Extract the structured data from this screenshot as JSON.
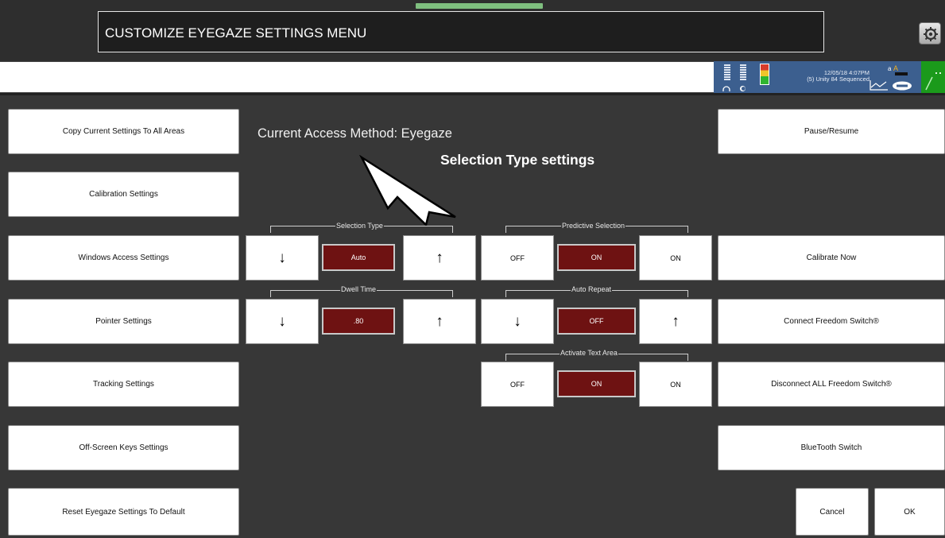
{
  "title": "CUSTOMIZE EYEGAZE SETTINGS MENU",
  "status": {
    "line1": "12/05/18 4:07PM",
    "line2": "(5) Unity 84 Sequenced",
    "icons": [
      "headphones-icon",
      "info-icon",
      "battery-icon",
      "chart-icon",
      "speech-bubble-icon",
      "ruler-icon",
      "settings-icon"
    ]
  },
  "access_method": "Current Access Method:  Eyegaze",
  "callout": "Selection Type settings",
  "left_buttons": [
    "Copy Current Settings To All Areas",
    "Calibration Settings",
    "Windows Access Settings",
    "Pointer Settings",
    "Tracking Settings",
    "Off-Screen Keys Settings",
    "Reset Eyegaze Settings To Default"
  ],
  "right_buttons": [
    "Pause/Resume",
    "Calibrate Now",
    "Connect Freedom Switch®",
    "Disconnect ALL Freedom Switch®",
    "BlueTooth Switch"
  ],
  "selection_type": {
    "label": "Selection Type",
    "value": "Auto",
    "down": "↓",
    "up": "↑"
  },
  "dwell_time": {
    "label": "Dwell Time",
    "value": ".80",
    "down": "↓",
    "up": "↑"
  },
  "predictive_selection": {
    "label": "Predictive Selection",
    "off": "OFF",
    "value": "ON",
    "on": "ON"
  },
  "auto_repeat": {
    "label": "Auto Repeat",
    "value": "OFF",
    "down": "↓",
    "up": "↑"
  },
  "activate_text_area": {
    "label": "Activate Text Area",
    "off": "OFF",
    "value": "ON",
    "on": "ON"
  },
  "cancel_label": "Cancel",
  "ok_label": "OK",
  "colors": {
    "background": "#373737",
    "value_box": "#6e1212",
    "status_panel": "#3c5f8f",
    "status_green": "#1b9a1b"
  }
}
